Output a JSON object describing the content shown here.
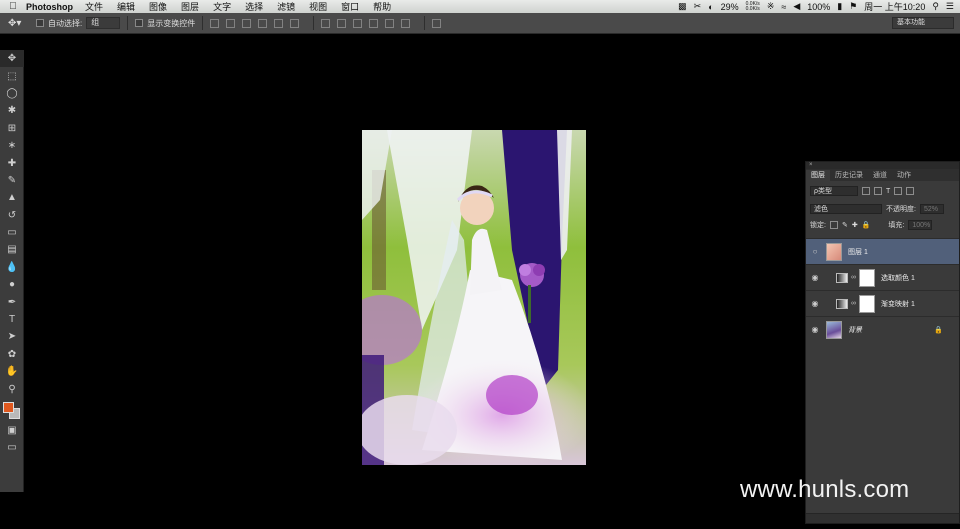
{
  "menubar": {
    "apple": "",
    "app": "Photoshop",
    "items": [
      "文件",
      "编辑",
      "图像",
      "图层",
      "文字",
      "选择",
      "滤镜",
      "视图",
      "窗口",
      "帮助"
    ],
    "cpu": "29%",
    "net_up": "0.0K/s",
    "net_down": "0.0K/s",
    "battery": "100%",
    "datetime": "周一 上午10:20"
  },
  "optionsbar": {
    "tool_icon": "move-tool-icon",
    "auto_select_label": "自动选择:",
    "auto_select_value": "组",
    "show_transform_label": "显示变换控件",
    "workspace": "基本功能"
  },
  "tools": [
    "move",
    "marquee",
    "lasso",
    "quick-select",
    "crop",
    "eyedropper",
    "healing",
    "brush",
    "stamp",
    "history-brush",
    "eraser",
    "gradient",
    "blur",
    "dodge",
    "pen",
    "type",
    "path-select",
    "shape",
    "hand",
    "zoom"
  ],
  "colors": {
    "foreground": "#e0581e",
    "background": "#b9b9b9"
  },
  "layers_panel": {
    "tabs": [
      "图层",
      "历史记录",
      "通道",
      "动作"
    ],
    "filter_kind": "ρ类型",
    "blend_mode": "滤色",
    "opacity_label": "不透明度:",
    "opacity_value": "52%",
    "lock_label": "锁定:",
    "fill_label": "填充:",
    "fill_value": "100%",
    "layers": [
      {
        "name": "图层 1",
        "selected": true
      },
      {
        "name": "选取颜色 1",
        "selected": false
      },
      {
        "name": "渐变映射 1",
        "selected": false
      },
      {
        "name": "背景",
        "selected": false
      }
    ]
  },
  "watermark": "www.hunls.com"
}
